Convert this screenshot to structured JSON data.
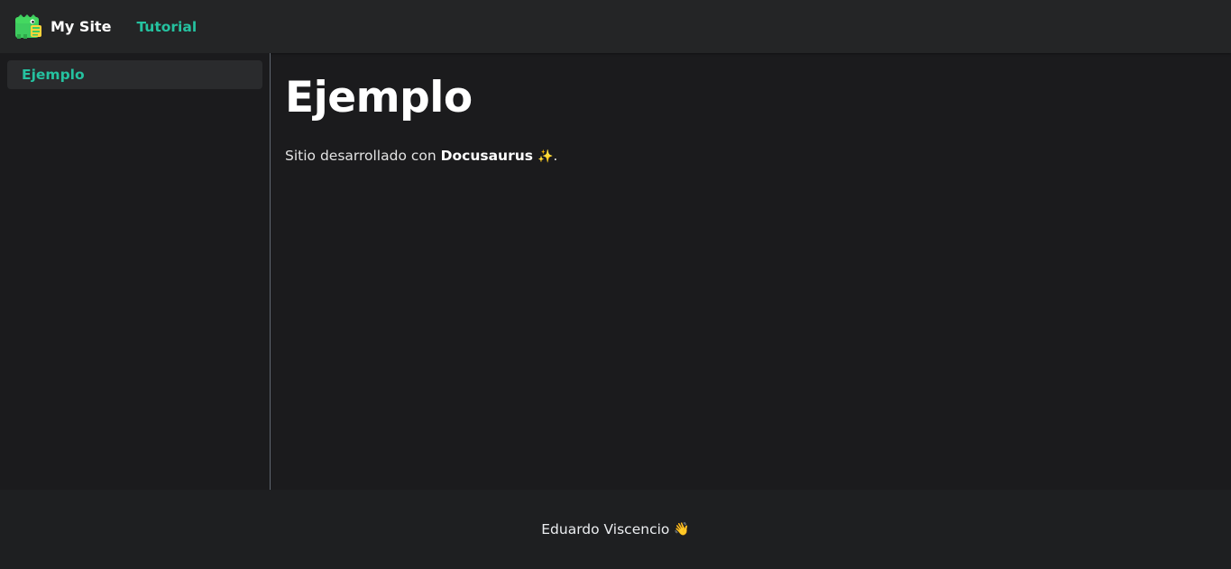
{
  "navbar": {
    "site_title": "My Site",
    "links": [
      {
        "label": "Tutorial"
      }
    ]
  },
  "sidebar": {
    "items": [
      {
        "label": "Ejemplo",
        "active": true
      }
    ]
  },
  "doc": {
    "title": "Ejemplo",
    "paragraph_prefix": "Sitio desarrollado con ",
    "paragraph_bold": "Docusaurus",
    "paragraph_emoji": "✨",
    "paragraph_suffix": "."
  },
  "footer": {
    "text": "Eduardo Viscencio",
    "emoji": "👋"
  },
  "colors": {
    "accent": "#25c2a0",
    "navbar_bg": "#242526",
    "page_bg": "#1b1b1d"
  },
  "icons": {
    "logo": "dinosaur-logo-icon"
  }
}
